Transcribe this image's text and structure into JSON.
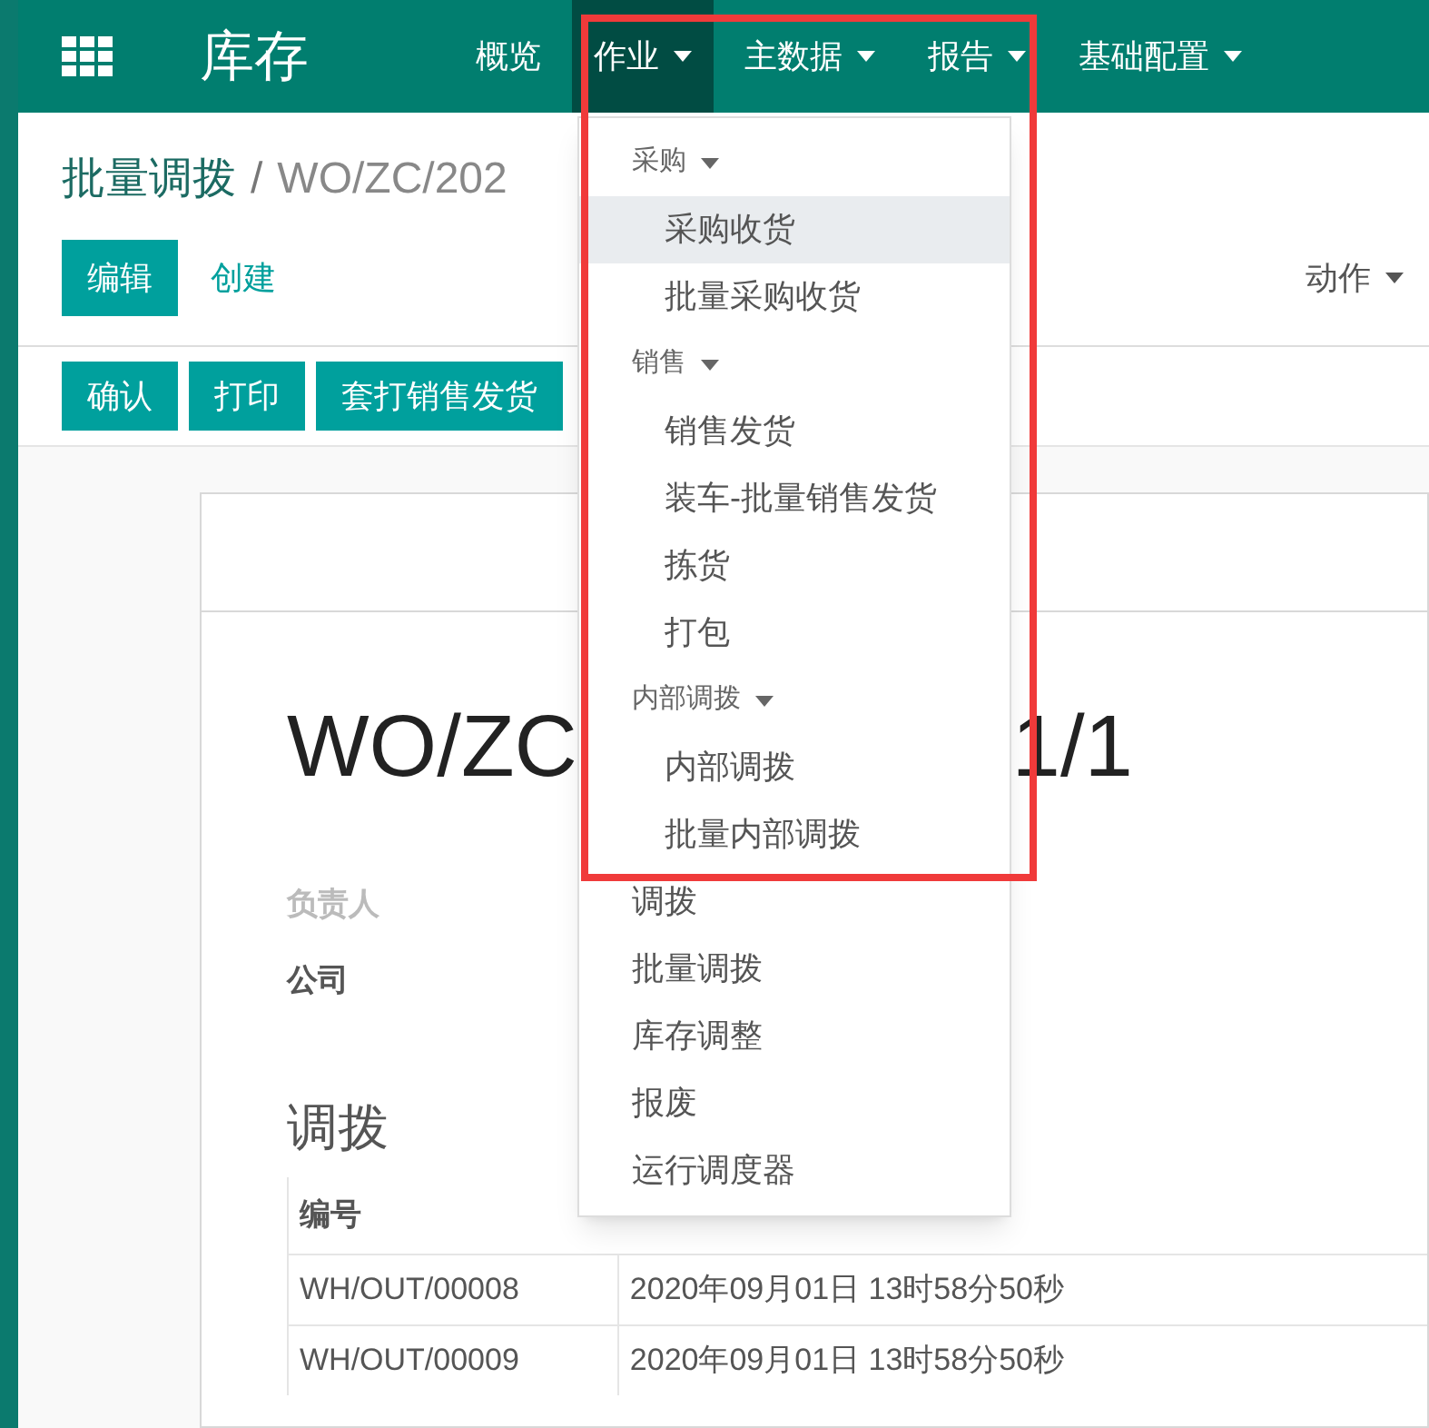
{
  "app": {
    "title": "库存"
  },
  "nav": [
    {
      "label": "概览",
      "selected": false,
      "dropdown": false
    },
    {
      "label": "作业",
      "selected": true,
      "dropdown": true
    },
    {
      "label": "主数据",
      "selected": false,
      "dropdown": true
    },
    {
      "label": "报告",
      "selected": false,
      "dropdown": true
    },
    {
      "label": "基础配置",
      "selected": false,
      "dropdown": true
    }
  ],
  "breadcrumb": {
    "parent": "批量调拨",
    "separator": "/",
    "current": "WO/ZC/202"
  },
  "buttons": {
    "primary": "编辑",
    "secondary": "创建",
    "actions": "动作"
  },
  "status_buttons": [
    "确认",
    "打印",
    "套打销售发货"
  ],
  "sheet": {
    "title_parts": [
      "WO/ZC",
      "1/1"
    ],
    "fields": [
      {
        "label": "负责人",
        "muted": true
      },
      {
        "label": "公司",
        "muted": false
      }
    ],
    "section": "调拨",
    "table": {
      "columns": [
        "编号"
      ],
      "rows": [
        [
          "WH/OUT/00008",
          "2020年09月01日 13时58分50秒"
        ],
        [
          "WH/OUT/00009",
          "2020年09月01日 13时58分50秒"
        ]
      ]
    }
  },
  "menu": [
    {
      "kind": "section",
      "label": "采购",
      "children": [
        {
          "label": "采购收货",
          "selected": true
        },
        {
          "label": "批量采购收货",
          "selected": false
        }
      ]
    },
    {
      "kind": "section",
      "label": "销售",
      "children": [
        {
          "label": "销售发货",
          "selected": false
        },
        {
          "label": "装车-批量销售发货",
          "selected": false
        },
        {
          "label": "拣货",
          "selected": false
        },
        {
          "label": "打包",
          "selected": false
        }
      ]
    },
    {
      "kind": "section",
      "label": "内部调拨",
      "children": [
        {
          "label": "内部调拨",
          "selected": false
        },
        {
          "label": "批量内部调拨",
          "selected": false
        }
      ]
    },
    {
      "kind": "item",
      "label": "调拨",
      "selected": false
    },
    {
      "kind": "item",
      "label": "批量调拨",
      "selected": false
    },
    {
      "kind": "item",
      "label": "库存调整",
      "selected": false
    },
    {
      "kind": "item",
      "label": "报废",
      "selected": false
    },
    {
      "kind": "item",
      "label": "运行调度器",
      "selected": false
    }
  ]
}
